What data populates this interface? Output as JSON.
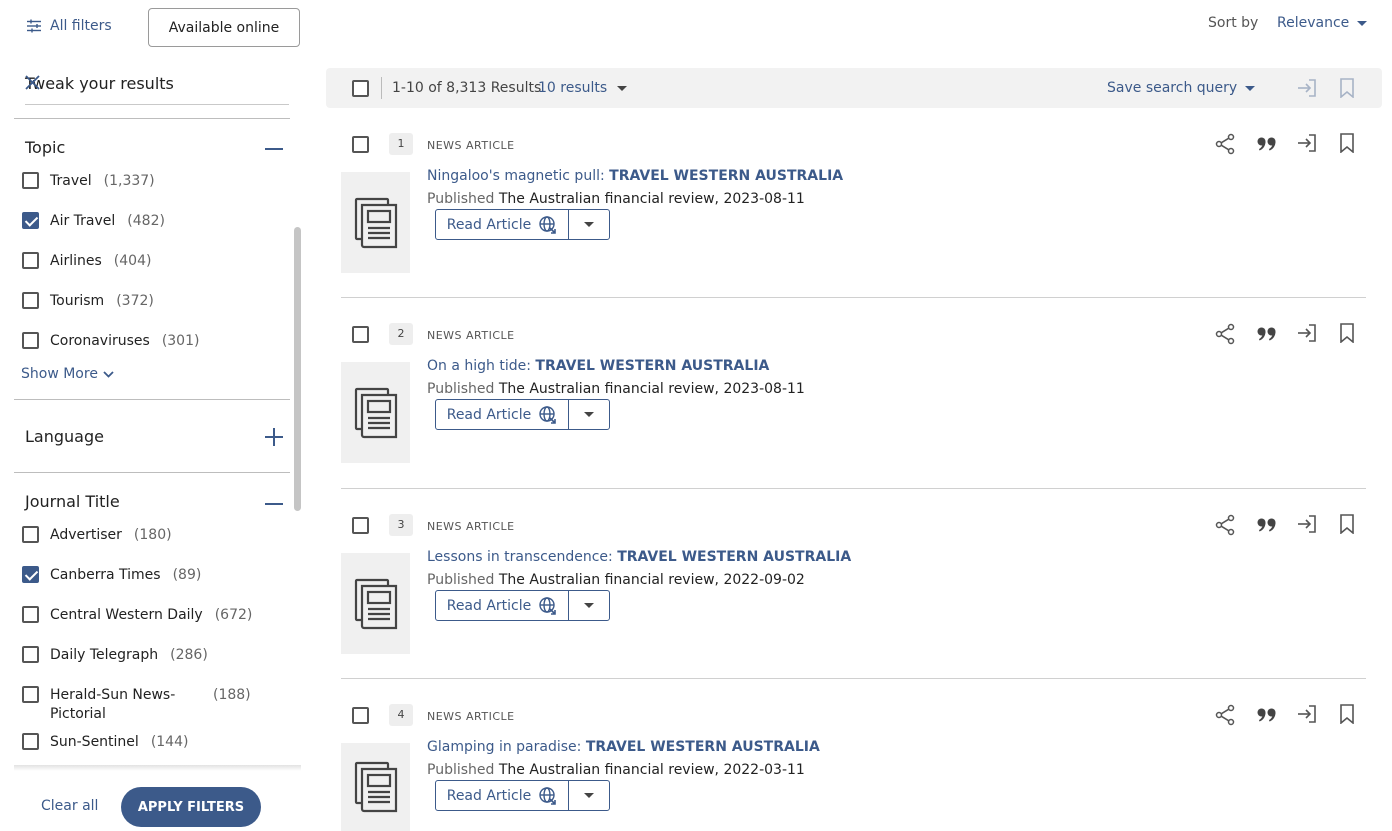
{
  "toolbar": {
    "all_filters": "All filters",
    "available_online": "Available online",
    "sort_by_label": "Sort by",
    "sort_value": "Relevance"
  },
  "filters": {
    "tweak_label": "Tweak your results",
    "topic": {
      "title": "Topic",
      "options": [
        {
          "label": "Travel",
          "count": "(1,337)",
          "checked": false
        },
        {
          "label": "Air Travel",
          "count": "(482)",
          "checked": true
        },
        {
          "label": "Airlines",
          "count": "(404)",
          "checked": false
        },
        {
          "label": "Tourism",
          "count": "(372)",
          "checked": false
        },
        {
          "label": "Coronaviruses",
          "count": "(301)",
          "checked": false
        }
      ],
      "show_more": "Show More"
    },
    "language": {
      "title": "Language"
    },
    "journal": {
      "title": "Journal Title",
      "options": [
        {
          "label": "Advertiser",
          "count": "(180)",
          "checked": false
        },
        {
          "label": "Canberra Times",
          "count": "(89)",
          "checked": true
        },
        {
          "label": "Central Western Daily",
          "count": "(672)",
          "checked": false
        },
        {
          "label": "Daily Telegraph",
          "count": "(286)",
          "checked": false
        },
        {
          "label": "Herald-Sun News-Pictorial",
          "count": "(188)",
          "checked": false
        },
        {
          "label": "Sun-Sentinel",
          "count": "(144)",
          "checked": false
        }
      ]
    },
    "clear_all": "Clear all",
    "apply": "APPLY FILTERS"
  },
  "results_header": {
    "count_text": "1-10 of 8,313 Results",
    "per_page": "10 results",
    "save_query": "Save search query"
  },
  "results": [
    {
      "num": "1",
      "type": "NEWS ARTICLE",
      "title_prefix": "Ningaloo's magnetic pull: ",
      "title_bold": "TRAVEL WESTERN AUSTRALIA",
      "published_label": "Published",
      "source": "The Australian financial review, 2023-08-11",
      "read_label": "Read Article"
    },
    {
      "num": "2",
      "type": "NEWS ARTICLE",
      "title_prefix": "On a high tide: ",
      "title_bold": "TRAVEL WESTERN AUSTRALIA",
      "published_label": "Published",
      "source": "The Australian financial review, 2023-08-11",
      "read_label": "Read Article"
    },
    {
      "num": "3",
      "type": "NEWS ARTICLE",
      "title_prefix": "Lessons in transcendence: ",
      "title_bold": "TRAVEL WESTERN AUSTRALIA",
      "published_label": "Published",
      "source": "The Australian financial review, 2022-09-02",
      "read_label": "Read Article"
    },
    {
      "num": "4",
      "type": "NEWS ARTICLE",
      "title_prefix": "Glamping in paradise: ",
      "title_bold": "TRAVEL WESTERN AUSTRALIA",
      "published_label": "Published",
      "source": "The Australian financial review, 2022-03-11",
      "read_label": "Read Article"
    }
  ],
  "colors": {
    "accent": "#3c5a8a",
    "header_bg": "#f2f2f2",
    "thumb_bg": "#f0f0f0"
  }
}
